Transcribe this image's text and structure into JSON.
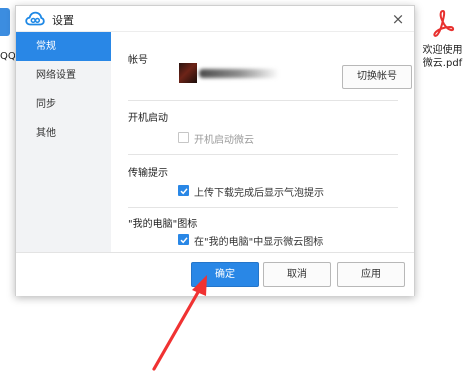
{
  "desktop": {
    "left_label": "QQ",
    "pdf_filename": "欢迎使用微云.pdf",
    "pdf_icon": "pdf-file-icon",
    "folder_icon": "folder-icon"
  },
  "dialog": {
    "title": "设置",
    "logo_icon": "weiyun-cloud-icon",
    "close_label": "×",
    "accent_color": "#2987e6"
  },
  "sidebar": {
    "items": [
      {
        "label": "常规",
        "active": true
      },
      {
        "label": "网络设置",
        "active": false
      },
      {
        "label": "同步",
        "active": false
      },
      {
        "label": "其他",
        "active": false
      }
    ]
  },
  "general": {
    "account": {
      "title": "帐号",
      "switch_label": "切换帐号"
    },
    "startup": {
      "title": "开机启动",
      "option_label": "开机启动微云",
      "checked": false,
      "disabled": true
    },
    "transfer": {
      "title": "传输提示",
      "option_label": "上传下载完成后显示气泡提示",
      "checked": true
    },
    "mycomputer": {
      "title": "\"我的电脑\"图标",
      "option_label": "在\"我的电脑\"中显示微云图标",
      "checked": true
    }
  },
  "footer": {
    "ok_label": "确定",
    "cancel_label": "取消",
    "apply_label": "应用"
  },
  "annotation": {
    "arrow_color": "#f03232"
  }
}
